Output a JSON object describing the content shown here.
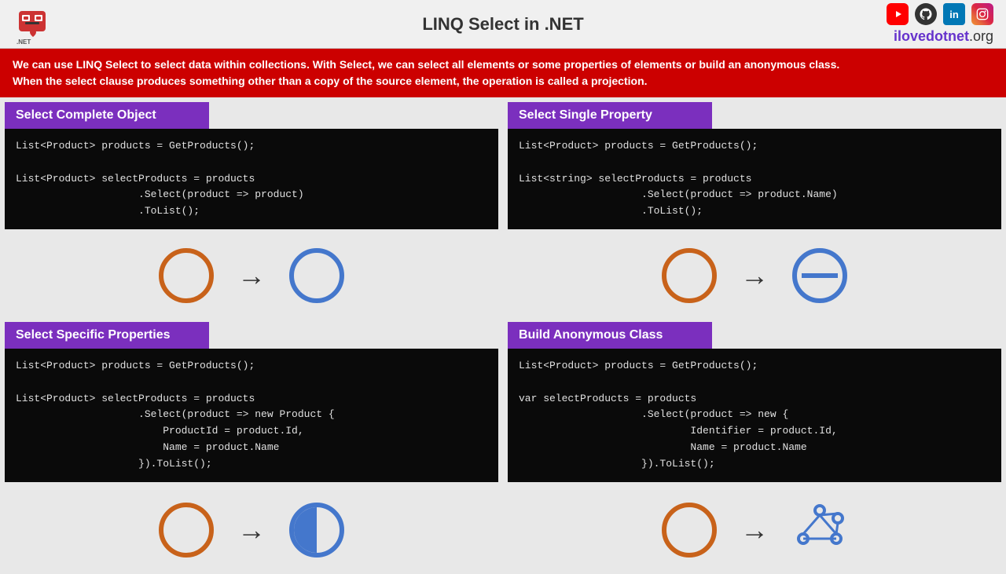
{
  "header": {
    "title": "LINQ Select in .NET",
    "brand_main": "ilovedotnet",
    "brand_suffix": ".org"
  },
  "banner": {
    "text_line1": "We can use LINQ Select to select data within collections. With Select, we can select all elements or some properties of elements or build an anonymous class.",
    "text_line2": "When the select clause produces something other than a copy of the source element, the operation is called a projection."
  },
  "sections": [
    {
      "id": "select-complete-object",
      "title": "Select Complete Object",
      "code": "List<Product> products = GetProducts();\n\nList<Product> selectProducts = products\n                    .Select(product => product)\n                    .ToList();"
    },
    {
      "id": "select-single-property",
      "title": "Select Single Property",
      "code": "List<Product> products = GetProducts();\n\nList<string> selectProducts = products\n                    .Select(product => product.Name)\n                    .ToList();"
    },
    {
      "id": "select-specific-properties",
      "title": "Select Specific Properties",
      "code": "List<Product> products = GetProducts();\n\nList<Product> selectProducts = products\n                    .Select(product => new Product {\n                        ProductId = product.Id,\n                        Name = product.Name\n                    }).ToList();"
    },
    {
      "id": "build-anonymous-class",
      "title": "Build Anonymous Class",
      "code": "List<Product> products = GetProducts();\n\nvar selectProducts = products\n                    .Select(product => new {\n                            Identifier = product.Id,\n                            Name = product.Name\n                    }).ToList();"
    }
  ],
  "social": {
    "youtube_label": "YT",
    "github_label": "GH",
    "linkedin_label": "in",
    "instagram_label": "Ig"
  }
}
